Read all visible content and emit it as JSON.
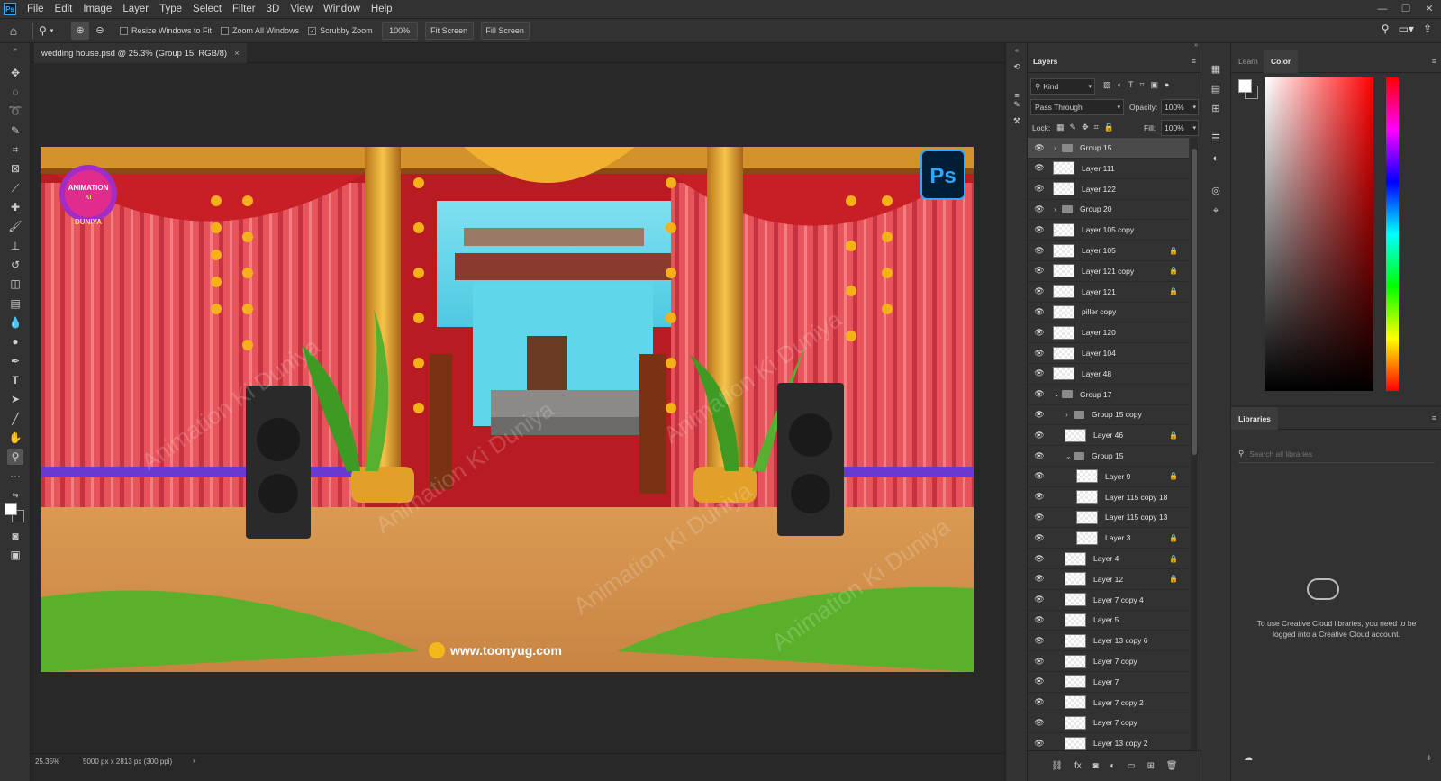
{
  "app": {
    "logo": "Ps"
  },
  "menu": [
    "File",
    "Edit",
    "Image",
    "Layer",
    "Type",
    "Select",
    "Filter",
    "3D",
    "View",
    "Window",
    "Help"
  ],
  "options_bar": {
    "resize_windows": "Resize Windows to Fit",
    "zoom_all": "Zoom All Windows",
    "scrubby_zoom": "Scrubby Zoom",
    "zoom_value": "100%",
    "fit_screen": "Fit Screen",
    "fill_screen": "Fill Screen"
  },
  "document": {
    "tab_title": "wedding house.psd @ 25.3% (Group 15, RGB/8)",
    "close": "×"
  },
  "artwork": {
    "website": "www.toonyug.com",
    "ps_badge": "Ps",
    "logo_line1": "ANIMATION",
    "logo_line2": "KI",
    "logo_line3": "DUNIYA",
    "watermark": "Animation Ki Duniya"
  },
  "status": {
    "zoom": "25.35%",
    "doc_size": "5000 px x 2813 px (300 ppi)",
    "arrow": "›"
  },
  "layers_panel": {
    "tab": "Layers",
    "filter": "Kind",
    "blend_mode": "Pass Through",
    "opacity_label": "Opacity:",
    "opacity_value": "100%",
    "lock_label": "Lock:",
    "fill_label": "Fill:",
    "fill_value": "100%",
    "layers": [
      {
        "name": "Group 15",
        "type": "group",
        "level": 0,
        "locked": false,
        "expanded": false,
        "selected": true
      },
      {
        "name": "Layer 111",
        "type": "layer",
        "level": 0,
        "locked": false
      },
      {
        "name": "Layer 122",
        "type": "layer",
        "level": 0,
        "locked": false
      },
      {
        "name": "Group 20",
        "type": "group",
        "level": 0,
        "locked": false,
        "expanded": false
      },
      {
        "name": "Layer 105 copy",
        "type": "layer",
        "level": 0,
        "locked": false
      },
      {
        "name": "Layer 105",
        "type": "layer",
        "level": 0,
        "locked": true
      },
      {
        "name": "Layer 121 copy",
        "type": "layer",
        "level": 0,
        "locked": true
      },
      {
        "name": "Layer 121",
        "type": "layer",
        "level": 0,
        "locked": true
      },
      {
        "name": "piller copy",
        "type": "layer",
        "level": 0,
        "locked": false
      },
      {
        "name": "Layer 120",
        "type": "layer",
        "level": 0,
        "locked": false
      },
      {
        "name": "Layer 104",
        "type": "layer",
        "level": 0,
        "locked": false
      },
      {
        "name": "Layer 48",
        "type": "layer",
        "level": 0,
        "locked": false
      },
      {
        "name": "Group 17",
        "type": "group",
        "level": 0,
        "locked": false,
        "expanded": true
      },
      {
        "name": "Group 15 copy",
        "type": "group",
        "level": 1,
        "locked": false,
        "expanded": false
      },
      {
        "name": "Layer 46",
        "type": "layer",
        "level": 1,
        "locked": true
      },
      {
        "name": "Group 15",
        "type": "group",
        "level": 1,
        "locked": false,
        "expanded": true
      },
      {
        "name": "Layer 9",
        "type": "layer",
        "level": 2,
        "locked": true
      },
      {
        "name": "Layer 115 copy 18",
        "type": "layer",
        "level": 2,
        "locked": false
      },
      {
        "name": "Layer 115 copy 13",
        "type": "layer",
        "level": 2,
        "locked": false
      },
      {
        "name": "Layer 3",
        "type": "layer",
        "level": 2,
        "locked": true
      },
      {
        "name": "Layer 4",
        "type": "layer",
        "level": 1,
        "locked": true
      },
      {
        "name": "Layer 12",
        "type": "layer",
        "level": 1,
        "locked": true
      },
      {
        "name": "Layer 7 copy 4",
        "type": "layer",
        "level": 1,
        "locked": false
      },
      {
        "name": "Layer 5",
        "type": "layer",
        "level": 1,
        "locked": false
      },
      {
        "name": "Layer 13 copy 6",
        "type": "layer",
        "level": 1,
        "locked": false
      },
      {
        "name": "Layer 7 copy",
        "type": "layer",
        "level": 1,
        "locked": false
      },
      {
        "name": "Layer 7",
        "type": "layer",
        "level": 1,
        "locked": false
      },
      {
        "name": "Layer 7 copy 2",
        "type": "layer",
        "level": 1,
        "locked": false
      },
      {
        "name": "Layer 7 copy",
        "type": "layer",
        "level": 1,
        "locked": false
      },
      {
        "name": "Layer 13 copy 2",
        "type": "layer",
        "level": 1,
        "locked": false
      }
    ]
  },
  "color_panel": {
    "tab_learn": "Learn",
    "tab_color": "Color"
  },
  "libraries_panel": {
    "tab": "Libraries",
    "search_placeholder": "Search all libraries",
    "message": "To use Creative Cloud libraries, you need to be logged into a Creative Cloud account."
  },
  "colors": {
    "accent": "#31a8ff",
    "panel": "#323232",
    "canvas": "#282828",
    "selected_row": "#4a4a4a"
  }
}
